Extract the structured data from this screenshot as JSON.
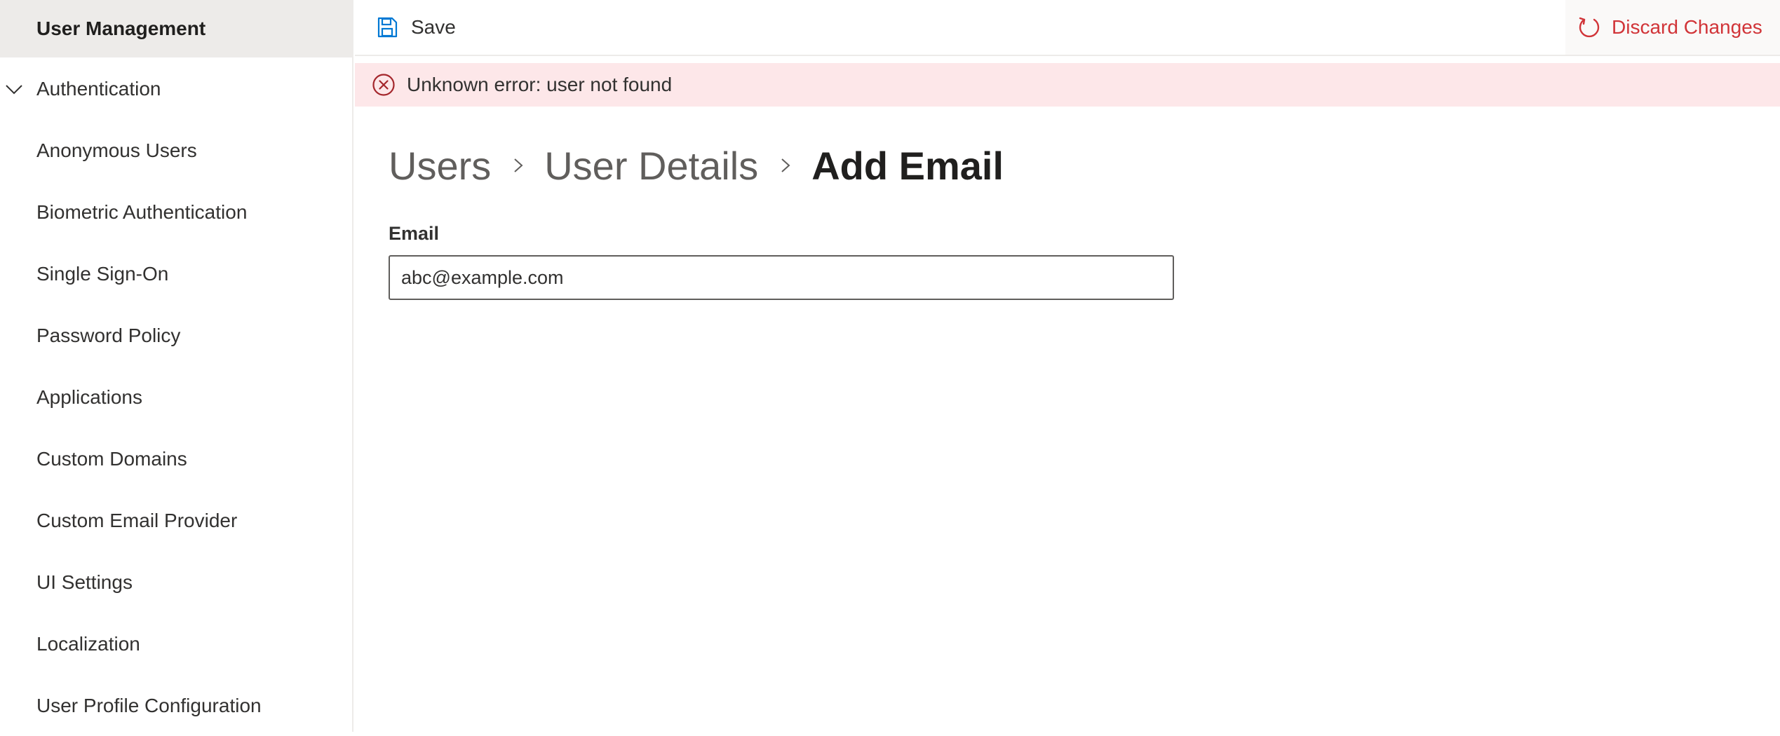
{
  "sidebar": {
    "selected": "User Management",
    "group": {
      "label": "Authentication",
      "icon": "chevron-down-icon",
      "expanded": true
    },
    "items": [
      {
        "label": "Anonymous Users"
      },
      {
        "label": "Biometric Authentication"
      },
      {
        "label": "Single Sign-On"
      },
      {
        "label": "Password Policy"
      },
      {
        "label": "Applications"
      },
      {
        "label": "Custom Domains"
      },
      {
        "label": "Custom Email Provider"
      },
      {
        "label": "UI Settings"
      },
      {
        "label": "Localization"
      },
      {
        "label": "User Profile Configuration"
      }
    ]
  },
  "toolbar": {
    "save_label": "Save",
    "save_icon": "save-icon",
    "discard_label": "Discard Changes",
    "discard_icon": "refresh-icon"
  },
  "message": {
    "icon": "error-circle-icon",
    "text": "Unknown error: user not found"
  },
  "breadcrumb": {
    "items": [
      "Users",
      "User Details"
    ],
    "current": "Add Email"
  },
  "form": {
    "email_label": "Email",
    "email_value": "abc@example.com"
  },
  "colors": {
    "accent": "#0078d4",
    "danger": "#d13438",
    "error_background": "#fde7e9",
    "selected_background": "#edebe9"
  }
}
